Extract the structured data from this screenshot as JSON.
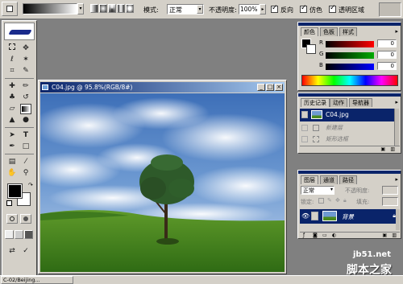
{
  "options_bar": {
    "mode_label": "模式:",
    "mode_value": "正常",
    "opacity_label": "不透明度:",
    "opacity_value": "100%",
    "reverse_label": "反向",
    "dither_label": "仿色",
    "transparency_label": "透明区域"
  },
  "document": {
    "title": "C04.jpg @ 95.8%(RGB/8#)"
  },
  "color_palette": {
    "tabs": [
      "颜色",
      "色板",
      "样式"
    ],
    "r_label": "R",
    "g_label": "G",
    "b_label": "B",
    "r_value": "0",
    "g_value": "0",
    "b_value": "0"
  },
  "history_palette": {
    "tabs": [
      "历史记录",
      "动作",
      "导航器"
    ],
    "snapshot_label": "C04.jpg",
    "items": [
      "新建层",
      "矩形选框"
    ]
  },
  "layers_palette": {
    "tabs": [
      "图层",
      "通道",
      "路径"
    ],
    "blend_mode": "正常",
    "opacity_label": "不透明度:",
    "lock_label": "锁定:",
    "fill_label": "填充:",
    "layer_name": "背景"
  },
  "taskbar": {
    "item_label": "C-02/Beijing..."
  },
  "watermark": {
    "site": "jb51.net",
    "brand": "脚本之家"
  },
  "colors": {
    "workspace": "#808080",
    "chrome": "#d4d0c8",
    "title_active": "#0a246a",
    "title_fade": "#a6caf0",
    "selection": "#0a246a"
  }
}
